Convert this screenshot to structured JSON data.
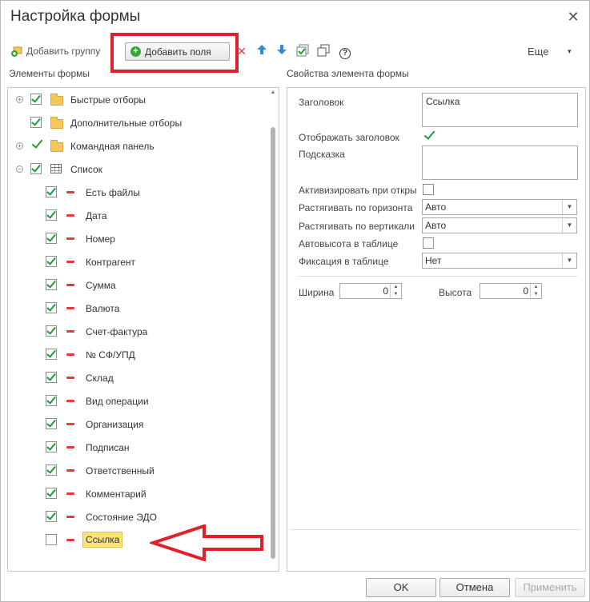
{
  "window": {
    "title": "Настройка формы"
  },
  "toolbar": {
    "add_group_label": "Добавить группу",
    "add_fields_label": "Добавить поля",
    "more_label": "Еще",
    "more_caret": "▾",
    "help_glyph": "?"
  },
  "panels": {
    "elements_header": "Элементы формы",
    "properties_header": "Свойства элемента формы"
  },
  "tree": {
    "top_items": [
      {
        "label": "Быстрые отборы"
      },
      {
        "label": "Дополнительные отборы"
      },
      {
        "label": "Командная панель"
      },
      {
        "label": "Список"
      }
    ],
    "list_items": [
      {
        "label": "Есть файлы",
        "checked": true
      },
      {
        "label": "Дата",
        "checked": true
      },
      {
        "label": "Номер",
        "checked": true
      },
      {
        "label": "Контрагент",
        "checked": true
      },
      {
        "label": "Сумма",
        "checked": true
      },
      {
        "label": "Валюта",
        "checked": true
      },
      {
        "label": "Счет-фактура",
        "checked": true
      },
      {
        "label": "№ СФ/УПД",
        "checked": true
      },
      {
        "label": "Склад",
        "checked": true
      },
      {
        "label": "Вид операции",
        "checked": true
      },
      {
        "label": "Организация",
        "checked": true
      },
      {
        "label": "Подписан",
        "checked": true
      },
      {
        "label": "Ответственный",
        "checked": true
      },
      {
        "label": "Комментарий",
        "checked": true
      },
      {
        "label": "Состояние ЭДО",
        "checked": true
      },
      {
        "label": "Ссылка",
        "checked": false,
        "selected": true
      }
    ]
  },
  "properties": {
    "title_label": "Заголовок",
    "title_value": "Ссылка",
    "show_title_label": "Отображать заголовок",
    "hint_label": "Подсказка",
    "hint_value": "",
    "activate_label": "Активизировать при откры",
    "stretch_h_label": "Растягивать по горизонта",
    "stretch_h_value": "Авто",
    "stretch_v_label": "Растягивать по вертикали",
    "stretch_v_value": "Авто",
    "autoheight_label": "Автовысота в таблице",
    "fix_label": "Фиксация в таблице",
    "fix_value": "Нет",
    "width_label": "Ширина",
    "width_value": "0",
    "height_label": "Высота",
    "height_value": "0"
  },
  "buttons": {
    "ok": "OK",
    "cancel": "Отмена",
    "apply": "Применить"
  },
  "colors": {
    "highlight_red": "#e0202a",
    "check_green": "#1e9b3a",
    "selection_yellow": "#fbe27a"
  }
}
